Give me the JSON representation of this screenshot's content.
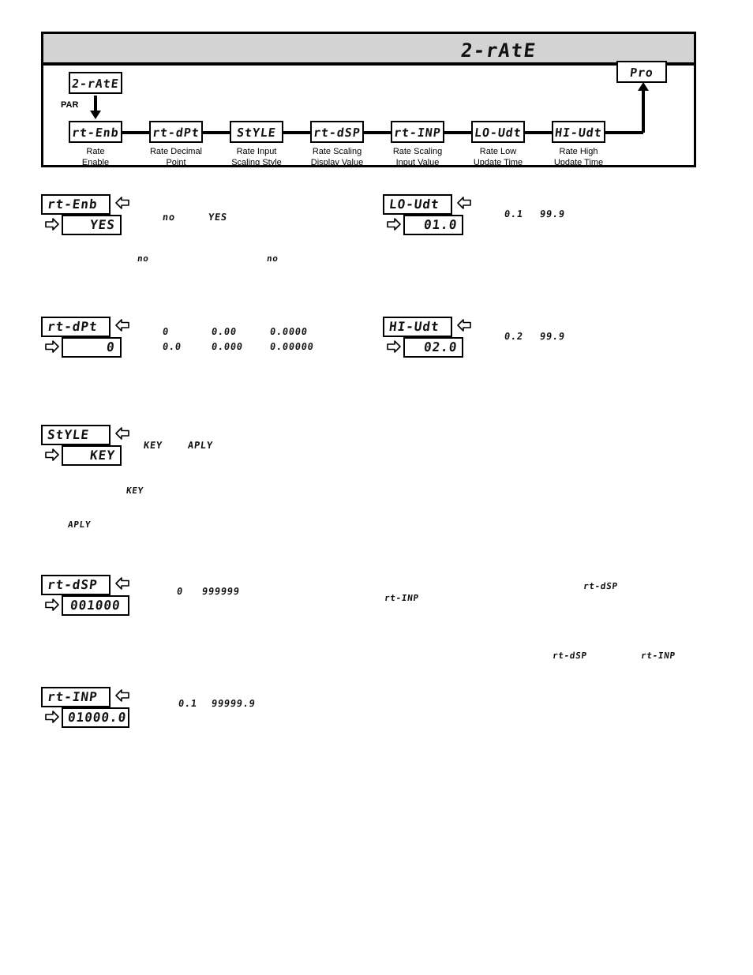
{
  "page": {
    "title_display": "2-rAtE"
  },
  "flow": {
    "start_box": "2-rAtE",
    "par_label": "PAR",
    "end_box": "Pro",
    "steps": [
      {
        "code": "rt-Enb",
        "label_line1": "Rate",
        "label_line2": "Enable"
      },
      {
        "code": "rt-dPt",
        "label_line1": "Rate Decimal",
        "label_line2": "Point"
      },
      {
        "code": "StYLE",
        "label_line1": "Rate Input",
        "label_line2": "Scaling Style"
      },
      {
        "code": "rt-dSP",
        "label_line1": "Rate Scaling",
        "label_line2": "Display Value"
      },
      {
        "code": "rt-INP",
        "label_line1": "Rate Scaling",
        "label_line2": "Input Value"
      },
      {
        "code": "LO-Udt",
        "label_line1": "Rate Low",
        "label_line2": "Update Time"
      },
      {
        "code": "HI-Udt",
        "label_line1": "Rate High",
        "label_line2": "Update Time"
      }
    ]
  },
  "params": {
    "rt_enb": {
      "name": "rt-Enb",
      "value": "YES",
      "options": [
        "no",
        "YES"
      ],
      "refs": [
        "no",
        "no"
      ]
    },
    "rt_dpt": {
      "name": "rt-dPt",
      "value": "0",
      "options_row1": [
        "0",
        "0.00",
        "0.0000"
      ],
      "options_row2": [
        "0.0",
        "0.000",
        "0.00000"
      ]
    },
    "style": {
      "name": "StYLE",
      "value": "KEY",
      "options": [
        "KEY",
        "APLY"
      ],
      "refs": [
        "KEY",
        "APLY"
      ]
    },
    "rt_dsp": {
      "name": "rt-dSP",
      "value": "001000",
      "range_min": "0",
      "range_max": "999999"
    },
    "rt_inp": {
      "name": "rt-INP",
      "value": "01000.0",
      "range_min": "0.1",
      "range_max": "99999.9"
    },
    "lo_udt": {
      "name": "LO-Udt",
      "value": "01.0",
      "range_min": "0.1",
      "range_max": "99.9"
    },
    "hi_udt": {
      "name": "HI-Udt",
      "value": "02.0",
      "range_min": "0.2",
      "range_max": "99.9"
    }
  },
  "body_refs": {
    "ref_rt_inp_1": "rt-INP",
    "ref_rt_dsp_1": "rt-dSP",
    "ref_rt_dsp_2": "rt-dSP",
    "ref_rt_inp_2": "rt-INP"
  }
}
